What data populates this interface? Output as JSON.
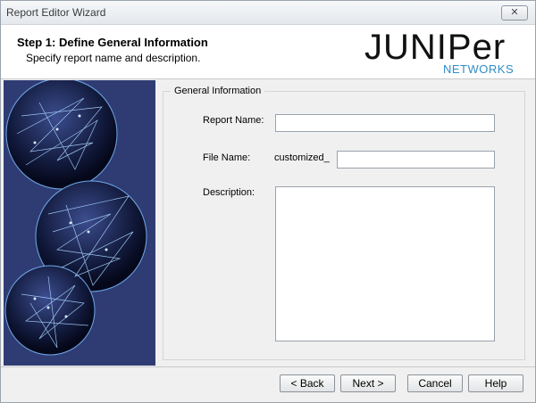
{
  "window": {
    "title": "Report Editor Wizard",
    "close_label": "✕"
  },
  "header": {
    "step_title": "Step 1: Define General Information",
    "step_subtitle": "Specify report name and description.",
    "logo": {
      "word": "JUNIPer",
      "sub": "NETWORKS"
    }
  },
  "form": {
    "group_label": "General Information",
    "report_name_label": "Report Name:",
    "report_name_value": "",
    "file_name_label": "File Name:",
    "file_name_prefix": "customized_",
    "file_name_value": "",
    "description_label": "Description:",
    "description_value": ""
  },
  "buttons": {
    "back": "< Back",
    "next": "Next >",
    "cancel": "Cancel",
    "help": "Help"
  },
  "colors": {
    "side_panel_bg": "#2f3c73",
    "globe_glow": "#8fc6ff"
  }
}
